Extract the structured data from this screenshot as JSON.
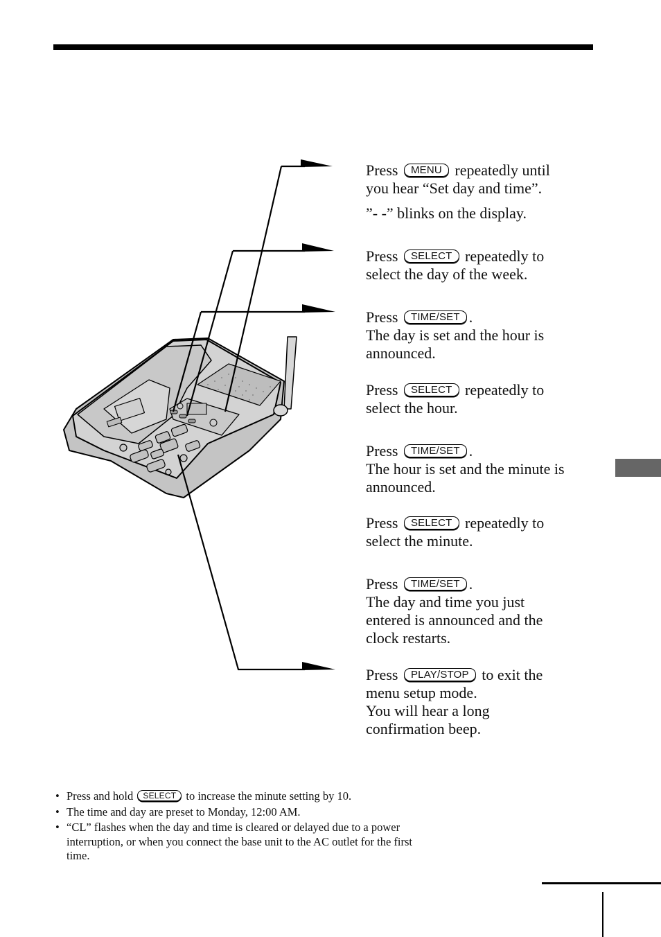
{
  "steps": [
    {
      "lines": [
        {
          "before": "Press",
          "key": "MENU",
          "after": "repeatedly until"
        },
        {
          "text": "you hear “Set day and time”."
        }
      ],
      "extra": "”- -” blinks on the display."
    },
    {
      "lines": [
        {
          "before": "Press",
          "key": "SELECT",
          "after": "repeatedly to"
        },
        {
          "text": "select the day of the week."
        }
      ]
    },
    {
      "lines": [
        {
          "before": "Press",
          "key": "TIME/SET",
          "after": "."
        },
        {
          "text": "The day is set and the hour is"
        },
        {
          "text": "announced."
        }
      ]
    },
    {
      "lines": [
        {
          "before": "Press",
          "key": "SELECT",
          "after": "repeatedly to"
        },
        {
          "text": "select the hour."
        }
      ]
    },
    {
      "lines": [
        {
          "before": "Press",
          "key": "TIME/SET",
          "after": "."
        },
        {
          "text": "The hour is set and the minute is"
        },
        {
          "text": "announced."
        }
      ]
    },
    {
      "lines": [
        {
          "before": "Press",
          "key": "SELECT",
          "after": "repeatedly to"
        },
        {
          "text": "select the minute."
        }
      ]
    },
    {
      "lines": [
        {
          "before": "Press",
          "key": "TIME/SET",
          "after": "."
        },
        {
          "text": "The day and time you just"
        },
        {
          "text": "entered is announced and the"
        },
        {
          "text": "clock restarts."
        }
      ]
    },
    {
      "lines": [
        {
          "before": "Press",
          "key": "PLAY/STOP",
          "after": "to exit the"
        },
        {
          "text": "menu setup mode."
        },
        {
          "text": "You will hear a long"
        },
        {
          "text": "confirmation beep."
        }
      ]
    }
  ],
  "notes": [
    {
      "before": "Press and hold",
      "key": "SELECT",
      "after": "to increase the minute setting by 10."
    },
    {
      "text": "The time and day are preset to Monday, 12:00 AM."
    },
    {
      "text": "“CL” flashes when the day and time is cleared or delayed due to a power",
      "line2": "interruption, or when you connect the base unit to the AC outlet for the first",
      "line3": "time."
    }
  ],
  "bullet": "•",
  "illustration": {
    "subject": "cordless telephone base unit",
    "callouts": [
      "MENU",
      "SELECT",
      "TIME/SET",
      "PLAY/STOP"
    ]
  },
  "colors": {
    "rule": "#000000",
    "side_tab": "#666666",
    "phone_body": "#cfcfcf",
    "phone_dark": "#b5b5b5"
  }
}
